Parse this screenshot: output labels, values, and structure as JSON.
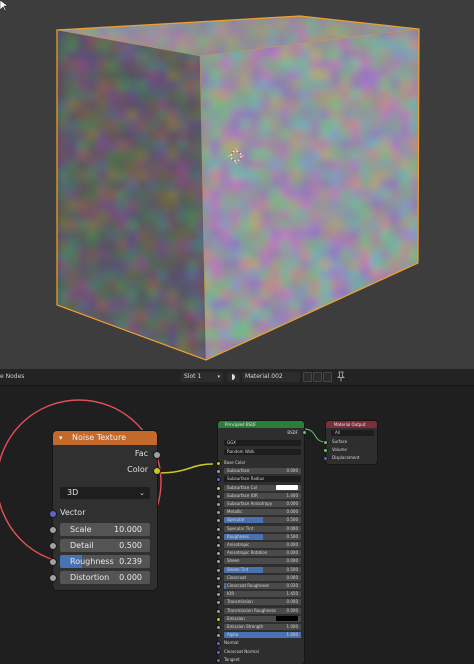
{
  "header": {
    "editor_label": "e Nodes",
    "slot": "Slot 1",
    "material": "Material.002"
  },
  "noise_texture": {
    "title": "Noise Texture",
    "outputs": [
      "Fac",
      "Color"
    ],
    "dimension": "3D",
    "vector_label": "Vector",
    "fields": [
      {
        "label": "Scale",
        "value": "10.000"
      },
      {
        "label": "Detail",
        "value": "0.500"
      },
      {
        "label": "Roughness",
        "value": "0.239",
        "fill": 0.239
      },
      {
        "label": "Distortion",
        "value": "0.000"
      }
    ]
  },
  "principled_bsdf": {
    "title": "Principled BSDF",
    "output": "BSDF",
    "distribution": "GGX",
    "subsurface_method": "Random Walk",
    "rows": [
      {
        "label": "Base Color",
        "kind": "socket"
      },
      {
        "label": "Subsurface",
        "value": "0.000",
        "fill": 0.0
      },
      {
        "label": "Subsurface Radius",
        "kind": "dropdown"
      },
      {
        "label": "Subsurface Col",
        "kind": "color",
        "color": "#ffffff"
      },
      {
        "label": "Subsurface IOR",
        "value": "1.400",
        "fill": 0.0
      },
      {
        "label": "Subsurface Anisotropy",
        "value": "0.000",
        "fill": 0.0
      },
      {
        "label": "Metallic",
        "value": "0.000",
        "fill": 0.0
      },
      {
        "label": "Specular",
        "value": "0.500",
        "fill": 0.5
      },
      {
        "label": "Specular Tint",
        "value": "0.000",
        "fill": 0.0
      },
      {
        "label": "Roughness",
        "value": "0.500",
        "fill": 0.5
      },
      {
        "label": "Anisotropic",
        "value": "0.000",
        "fill": 0.0
      },
      {
        "label": "Anisotropic Rotation",
        "value": "0.000",
        "fill": 0.0
      },
      {
        "label": "Sheen",
        "value": "0.000",
        "fill": 0.0
      },
      {
        "label": "Sheen Tint",
        "value": "0.500",
        "fill": 0.5
      },
      {
        "label": "Clearcoat",
        "value": "0.000",
        "fill": 0.0
      },
      {
        "label": "Clearcoat Roughness",
        "value": "0.030",
        "fill": 0.03
      },
      {
        "label": "IOR",
        "value": "1.450",
        "fill": 0.0
      },
      {
        "label": "Transmission",
        "value": "0.000",
        "fill": 0.0
      },
      {
        "label": "Transmission Roughness",
        "value": "0.000",
        "fill": 0.0
      },
      {
        "label": "Emission",
        "kind": "color",
        "color": "#000000"
      },
      {
        "label": "Emission Strength",
        "value": "1.000",
        "fill": 0.0
      },
      {
        "label": "Alpha",
        "value": "1.000",
        "fill": 1.0
      },
      {
        "label": "Normal",
        "kind": "plain"
      },
      {
        "label": "Clearcoat Normal",
        "kind": "plain"
      },
      {
        "label": "Tangent",
        "kind": "plain"
      }
    ]
  },
  "material_output": {
    "title": "Material Output",
    "target": "All",
    "inputs": [
      "Surface",
      "Volume",
      "Displacement"
    ]
  },
  "colors": {
    "noise_header": "#c2692b",
    "bsdf_header": "#2a7d3a",
    "output_header": "#7c2f3b",
    "selection_outline": "#f0a030",
    "circle_annotation": "#e0505a",
    "slider_fill": "#4772b3",
    "color_socket": "#c7c729",
    "vector_socket": "#6363c7",
    "float_socket": "#a1a1a1",
    "shader_socket": "#63c763"
  }
}
